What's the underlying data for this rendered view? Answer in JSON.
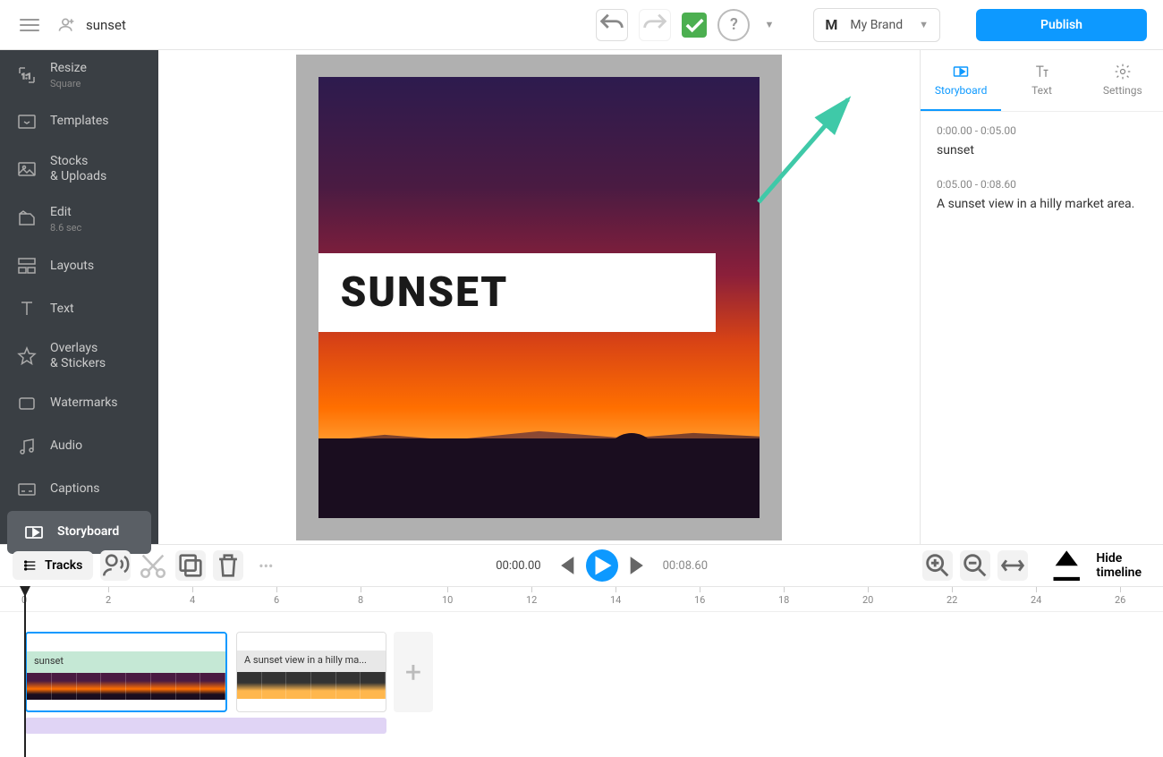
{
  "header": {
    "title": "sunset",
    "brand_badge": "M",
    "brand_label": "My Brand",
    "publish_label": "Publish"
  },
  "sidebar": {
    "items": [
      {
        "label": "Resize",
        "sub": "Square"
      },
      {
        "label": "Templates"
      },
      {
        "label": "Stocks\n& Uploads"
      },
      {
        "label": "Edit",
        "sub": "8.6 sec"
      },
      {
        "label": "Layouts"
      },
      {
        "label": "Text"
      },
      {
        "label": "Overlays\n& Stickers"
      },
      {
        "label": "Watermarks"
      },
      {
        "label": "Audio"
      },
      {
        "label": "Captions"
      },
      {
        "label": "Storyboard"
      }
    ]
  },
  "canvas": {
    "title_text": "SUNSET"
  },
  "right_panel": {
    "tabs": [
      "Storyboard",
      "Text",
      "Settings"
    ],
    "entries": [
      {
        "time": "0:00.00 - 0:05.00",
        "text": "sunset"
      },
      {
        "time": "0:05.00 - 0:08.60",
        "text": "A sunset view in a hilly market area."
      }
    ]
  },
  "controls": {
    "tracks_label": "Tracks",
    "current_time": "00:00.00",
    "total_time": "00:08.60",
    "hide_timeline_label": "Hide timeline"
  },
  "timeline": {
    "ruler": [
      "0",
      "2",
      "4",
      "6",
      "8",
      "10",
      "12",
      "14",
      "16",
      "18",
      "20",
      "22",
      "24",
      "26"
    ],
    "clips": [
      {
        "label": "sunset"
      },
      {
        "label": "A sunset view in a hilly ma..."
      }
    ]
  }
}
